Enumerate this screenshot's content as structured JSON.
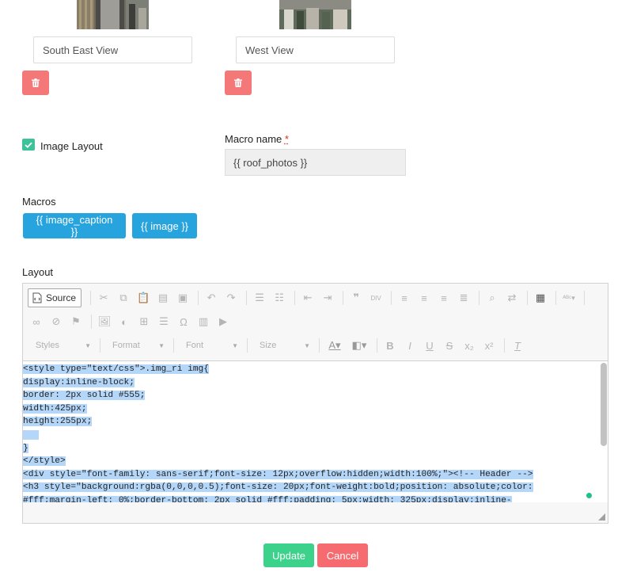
{
  "images": [
    {
      "caption_value": "South East View"
    },
    {
      "caption_value": "West View"
    }
  ],
  "image_layout": {
    "checked": true,
    "label": "Image Layout"
  },
  "macro_name": {
    "label": "Macro name",
    "required_mark": "*",
    "value": "{{ roof_photos }}"
  },
  "macros": {
    "label": "Macros",
    "items": [
      "{{ image_caption }}",
      "{{ image }}"
    ]
  },
  "layout": {
    "label": "Layout",
    "toolbar": {
      "source_label": "Source",
      "styles_label": "Styles",
      "format_label": "Format",
      "font_label": "Font",
      "size_label": "Size",
      "bold": "B",
      "italic": "I",
      "underline": "U",
      "strike": "S",
      "subscript": "x₂",
      "superscript": "x²",
      "omega": "Ω"
    },
    "code_lines": [
      "<style type=\"text/css\">.img_ri img{",
      "display:inline-block;",
      "border: 2px solid #555;",
      "width:425px;",
      "height:255px;",
      "   ",
      "}",
      "</style>",
      "<div style=\"font-family: sans-serif;font-size: 12px;overflow:hidden;width:100%;\"><!-- Header -->",
      "<h3 style=\"background:rgba(0,0,0,0.5);font-size: 20px;font-weight:bold;position: absolute;color:",
      "#fff;margin-left: 0%;border-bottom: 2px solid #fff;padding: 5px;width: 325px;display:inline-"
    ]
  },
  "actions": {
    "update_label": "Update",
    "cancel_label": "Cancel"
  },
  "colors": {
    "delete": "#f57878",
    "macro_button": "#27a3dd",
    "update": "#3dd28b",
    "cancel": "#f56b70",
    "checkbox": "#3ec29a",
    "selection": "#b4d6f9"
  }
}
